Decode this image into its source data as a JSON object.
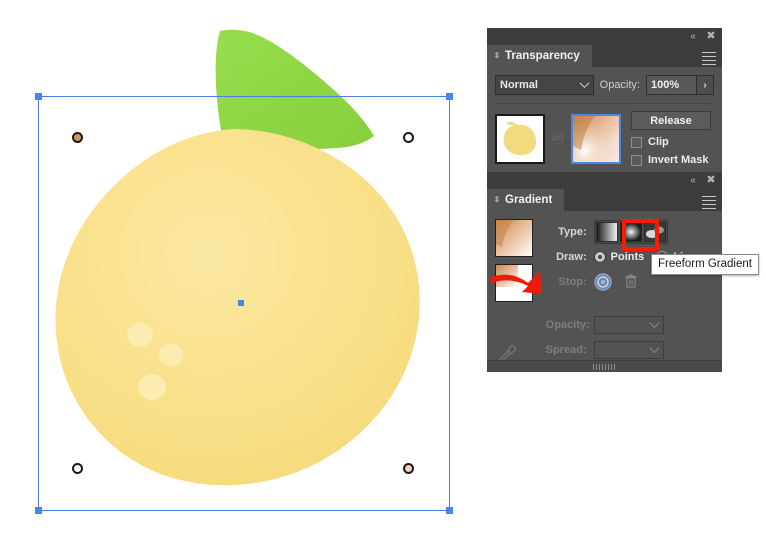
{
  "app": {
    "canvas_artwork": "lemon-with-leaf-illustration"
  },
  "transparency_panel": {
    "title": "Transparency",
    "collapse_icon": "double-chevron-left-icon",
    "close_icon": "close-icon",
    "menu_icon": "panel-menu-icon",
    "blend_mode": "Normal",
    "blend_mode_options": [
      "Normal"
    ],
    "opacity_label": "Opacity:",
    "opacity_value": "100%",
    "opacity_expand_icon": "chevron-right-icon",
    "object_thumbnail": "lemon-object-thumbnail",
    "link_icon": "link-icon",
    "mask_thumbnail": "opacity-mask-thumbnail",
    "release_label": "Release",
    "clip_label": "Clip",
    "clip_checked": false,
    "invert_mask_label": "Invert Mask",
    "invert_mask_checked": false
  },
  "gradient_panel": {
    "title": "Gradient",
    "collapse_icon": "double-chevron-left-icon",
    "close_icon": "close-icon",
    "menu_icon": "panel-menu-icon",
    "gradient_preview": "freeform-gradient-preview",
    "gradient_fill_swatch": "gradient-fill-stroke-swatch",
    "type_label": "Type:",
    "type_buttons": [
      {
        "name": "linear-gradient-button",
        "selected": false
      },
      {
        "name": "radial-gradient-button",
        "selected": false
      },
      {
        "name": "freeform-gradient-button",
        "selected": true
      }
    ],
    "draw_label": "Draw:",
    "draw_points_label": "Points",
    "draw_points_selected": true,
    "draw_lines_label": "Lines",
    "draw_lines_selected": false,
    "stop_label": "Stop:",
    "stop_color_icon": "gradient-stop-color-icon",
    "delete_stop_icon": "trash-icon",
    "eyedropper_icon": "eyedropper-icon",
    "opacity_label": "Opacity:",
    "opacity_value": "",
    "opacity_disabled": true,
    "spread_label": "Spread:",
    "spread_value": "",
    "spread_disabled": true,
    "resize_grip": "panel-resize-grip"
  },
  "annotations": {
    "tooltip_text": "Freeform Gradient",
    "highlight_color": "#f91b02",
    "arrow_icon": "red-arrow-annotation"
  },
  "selection": {
    "gradient_points": [
      {
        "name": "gradient-point-top-left",
        "color": "#d99559"
      },
      {
        "name": "gradient-point-top-right",
        "color": "#ffffff"
      },
      {
        "name": "gradient-point-bottom-left",
        "color": "#ffffff"
      },
      {
        "name": "gradient-point-bottom-right",
        "color": "#f7cfb4"
      }
    ],
    "center_anchor": "center-anchor-point",
    "bbox_color": "#4a86e8"
  },
  "colors": {
    "lemon_body": "#f9e08a",
    "lemon_leaf": "#8ed643",
    "panel_bg": "#535353",
    "panel_header": "#3d3d3d"
  }
}
